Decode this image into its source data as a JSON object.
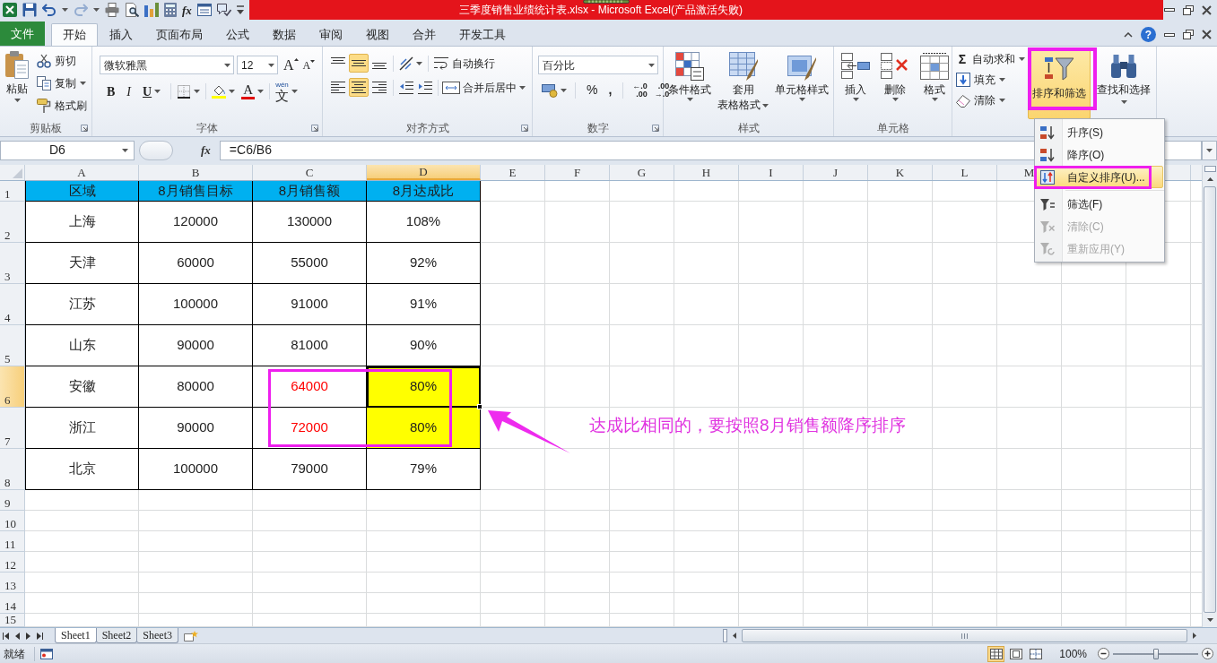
{
  "title_bar": {
    "quick_access": [
      {
        "kind": "save",
        "disabled": false
      },
      {
        "kind": "undo",
        "disabled": false,
        "dropdown": true
      },
      {
        "kind": "redo",
        "disabled": true,
        "dropdown": true
      },
      {
        "kind": "print",
        "disabled": false
      },
      {
        "kind": "print-preview",
        "disabled": false
      },
      {
        "kind": "columns",
        "disabled": false
      },
      {
        "kind": "calculator",
        "disabled": false
      },
      {
        "kind": "function",
        "label": "fx",
        "disabled": false
      },
      {
        "kind": "form",
        "disabled": false
      },
      {
        "kind": "comment",
        "disabled": false
      },
      {
        "kind": "customize",
        "disabled": false
      }
    ],
    "title": "三季度销售业绩统计表.xlsx - Microsoft Excel(产品激活失败)"
  },
  "ribbon_tabs": [
    {
      "label": "文件",
      "kind": "file",
      "selected": false
    },
    {
      "label": "开始",
      "kind": "tab",
      "selected": true
    },
    {
      "label": "插入",
      "kind": "tab",
      "selected": false
    },
    {
      "label": "页面布局",
      "kind": "tab",
      "selected": false
    },
    {
      "label": "公式",
      "kind": "tab",
      "selected": false
    },
    {
      "label": "数据",
      "kind": "tab",
      "selected": false
    },
    {
      "label": "审阅",
      "kind": "tab",
      "selected": false
    },
    {
      "label": "视图",
      "kind": "tab",
      "selected": false
    },
    {
      "label": "合并",
      "kind": "tab",
      "selected": false
    },
    {
      "label": "开发工具",
      "kind": "tab",
      "selected": false
    }
  ],
  "help": "?",
  "ribbon": {
    "clipboard": {
      "label": "剪贴板",
      "launcher": true,
      "paste": "粘贴",
      "buttons": [
        {
          "kind": "cut",
          "label": "剪切"
        },
        {
          "kind": "copy",
          "label": "复制",
          "dropdown": true
        },
        {
          "kind": "format-painter",
          "label": "格式刷"
        }
      ]
    },
    "font": {
      "label": "字体",
      "launcher": true,
      "font_name": "微软雅黑",
      "font_size": "12",
      "grow": "A",
      "shrink": "A",
      "styles": [
        {
          "kind": "bold",
          "label": "B"
        },
        {
          "kind": "italic",
          "label": "I"
        },
        {
          "kind": "underline",
          "label": "U",
          "dropdown": true
        }
      ],
      "font_color": "A",
      "phonetic": {
        "ruby": "wén",
        "label": "文"
      }
    },
    "alignment": {
      "label": "对齐方式",
      "launcher": true,
      "vertical": [
        {
          "kind": "top",
          "selected": false
        },
        {
          "kind": "middle",
          "selected": true
        },
        {
          "kind": "bottom",
          "selected": false
        }
      ],
      "wrap": "自动换行",
      "horizontal": [
        {
          "kind": "left",
          "selected": false
        },
        {
          "kind": "center",
          "selected": true
        },
        {
          "kind": "right",
          "selected": false
        }
      ],
      "merge": "合并后居中"
    },
    "number": {
      "label": "数字",
      "launcher": true,
      "format": "百分比",
      "percent": "%",
      "comma": ",",
      "increase_decimal": [
        "←.0",
        ".00"
      ],
      "decrease_decimal": [
        ".00",
        "→.0"
      ]
    },
    "styles": {
      "label": "样式",
      "buttons": [
        {
          "kind": "conditional",
          "lines": [
            "条件格式"
          ]
        },
        {
          "kind": "table",
          "lines": [
            "套用",
            "表格格式"
          ]
        },
        {
          "kind": "cell-styles",
          "lines": [
            "单元格样式"
          ]
        }
      ]
    },
    "cells": {
      "label": "单元格",
      "buttons": [
        {
          "kind": "insert",
          "label": "插入"
        },
        {
          "kind": "delete",
          "label": "删除"
        },
        {
          "kind": "format",
          "label": "格式"
        }
      ]
    },
    "editing": {
      "small": [
        {
          "kind": "autosum",
          "symbol": "Σ",
          "label": "自动求和",
          "dropdown": true
        },
        {
          "kind": "fill",
          "label": "填充",
          "dropdown": true
        },
        {
          "kind": "clear",
          "label": "清除",
          "dropdown": true
        }
      ],
      "sort_filter": {
        "label": "排序和筛选",
        "open": true
      },
      "find": {
        "label": "查找和选择"
      }
    }
  },
  "formula_bar": {
    "name_box": "D6",
    "function_button": "fx",
    "formula": "=C6/B6"
  },
  "sheet": {
    "columns": [
      {
        "label": "A",
        "selected": false
      },
      {
        "label": "B",
        "selected": false
      },
      {
        "label": "C",
        "selected": false
      },
      {
        "label": "D",
        "selected": true
      },
      {
        "label": "E",
        "selected": false
      },
      {
        "label": "F",
        "selected": false
      },
      {
        "label": "G",
        "selected": false
      },
      {
        "label": "H",
        "selected": false
      },
      {
        "label": "I",
        "selected": false
      },
      {
        "label": "J",
        "selected": false
      },
      {
        "label": "K",
        "selected": false
      },
      {
        "label": "L",
        "selected": false
      },
      {
        "label": "M",
        "selected": false
      }
    ],
    "rows": [
      {
        "label": "1",
        "selected": false,
        "cells": [
          {
            "text": "区域",
            "kind": "filled",
            "color": "#00b0f0"
          },
          {
            "text": "8月销售目标",
            "kind": "filled",
            "color": "#00b0f0"
          },
          {
            "text": "8月销售额",
            "kind": "filled",
            "color": "#00b0f0"
          },
          {
            "text": "8月达成比",
            "kind": "filled",
            "color": "#00b0f0"
          }
        ]
      },
      {
        "label": "2",
        "selected": false,
        "cells": [
          {
            "text": "上海"
          },
          {
            "text": "120000"
          },
          {
            "text": "130000"
          },
          {
            "text": "108%"
          }
        ]
      },
      {
        "label": "3",
        "selected": false,
        "cells": [
          {
            "text": "天津"
          },
          {
            "text": "60000"
          },
          {
            "text": "55000"
          },
          {
            "text": "92%"
          }
        ]
      },
      {
        "label": "4",
        "selected": false,
        "cells": [
          {
            "text": "江苏"
          },
          {
            "text": "100000"
          },
          {
            "text": "91000"
          },
          {
            "text": "91%"
          }
        ]
      },
      {
        "label": "5",
        "selected": false,
        "cells": [
          {
            "text": "山东"
          },
          {
            "text": "90000"
          },
          {
            "text": "81000"
          },
          {
            "text": "90%"
          }
        ]
      },
      {
        "label": "6",
        "selected": true,
        "cells": [
          {
            "text": "安徽"
          },
          {
            "text": "80000"
          },
          {
            "text": "64000",
            "kind": "colored-text",
            "color": "#ff0000"
          },
          {
            "text": "80%",
            "kind": "filled",
            "color": "#ffff00"
          }
        ]
      },
      {
        "label": "7",
        "selected": false,
        "cells": [
          {
            "text": "浙江"
          },
          {
            "text": "90000"
          },
          {
            "text": "72000",
            "kind": "colored-text",
            "color": "#ff0000"
          },
          {
            "text": "80%",
            "kind": "filled",
            "color": "#ffff00"
          }
        ]
      },
      {
        "label": "8",
        "selected": false,
        "cells": [
          {
            "text": "北京"
          },
          {
            "text": "100000"
          },
          {
            "text": "79000"
          },
          {
            "text": "79%"
          }
        ]
      },
      {
        "label": "9",
        "selected": false
      },
      {
        "label": "10",
        "selected": false
      },
      {
        "label": "11",
        "selected": false
      },
      {
        "label": "12",
        "selected": false
      },
      {
        "label": "13",
        "selected": false
      },
      {
        "label": "14",
        "selected": false
      },
      {
        "label": "15",
        "selected": false
      }
    ]
  },
  "annotation": "达成比相同的，要按照8月销售额降序排序",
  "sort_menu": {
    "items": [
      {
        "kind": "ascending",
        "label": "升序(S)",
        "highlighted": false,
        "disabled": false
      },
      {
        "kind": "descending",
        "label": "降序(O)",
        "highlighted": false,
        "disabled": false
      },
      {
        "kind": "custom",
        "label": "自定义排序(U)...",
        "highlighted": true,
        "disabled": false
      },
      {
        "kind": "filter",
        "label": "筛选(F)",
        "highlighted": false,
        "disabled": false
      },
      {
        "kind": "clear",
        "label": "清除(C)",
        "highlighted": false,
        "disabled": true
      },
      {
        "kind": "reapply",
        "label": "重新应用(Y)",
        "highlighted": false,
        "disabled": true
      }
    ]
  },
  "sheet_tabs": [
    {
      "label": "Sheet1",
      "selected": true
    },
    {
      "label": "Sheet2",
      "selected": false
    },
    {
      "label": "Sheet3",
      "selected": false
    }
  ],
  "status_bar": {
    "status": "就绪",
    "views": [
      {
        "kind": "normal",
        "selected": true
      },
      {
        "kind": "page-layout",
        "selected": false
      },
      {
        "kind": "page-break",
        "selected": false
      }
    ],
    "zoom": "100%",
    "zoom_slider": {
      "level": 0.5
    }
  }
}
